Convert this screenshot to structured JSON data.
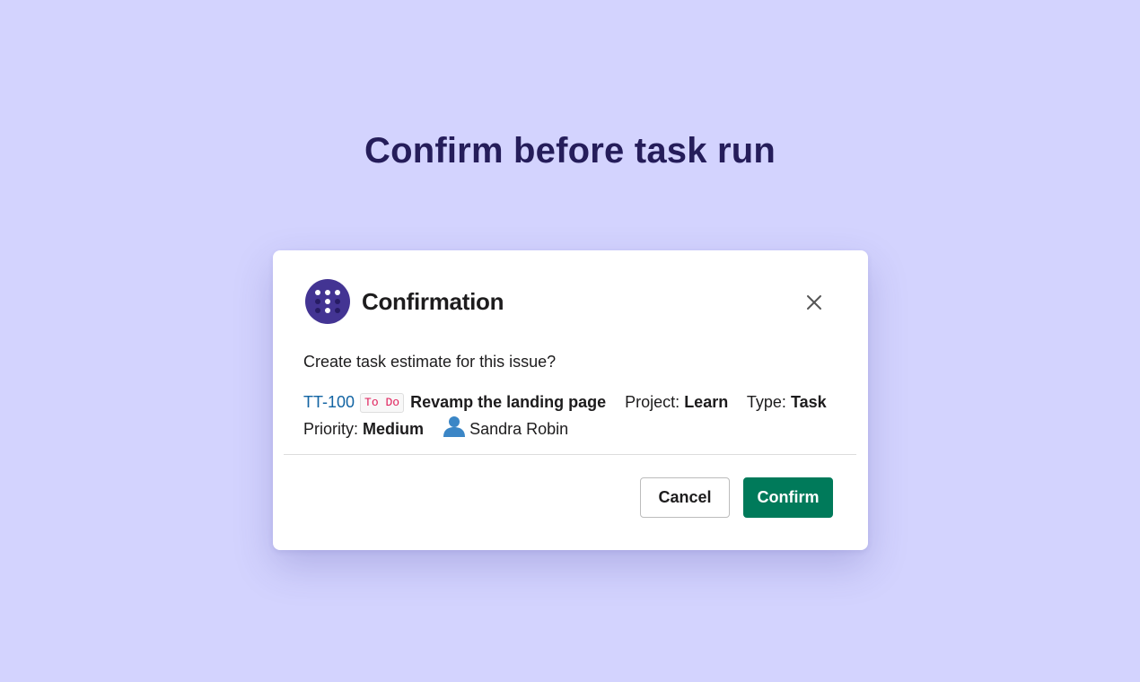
{
  "page": {
    "heading": "Confirm before task run",
    "background_color": "#d3d3fe"
  },
  "dialog": {
    "title": "Confirmation",
    "logo_icon": "dots-logo-icon",
    "close_icon": "close-icon",
    "question": "Create task estimate for this issue?",
    "issue": {
      "key": "TT-100",
      "status": "To Do",
      "summary": "Revamp the landing page",
      "project_label": "Project:",
      "project": "Learn",
      "type_label": "Type:",
      "type": "Task",
      "priority_label": "Priority:",
      "priority": "Medium",
      "assignee_icon": "user-icon",
      "assignee": "Sandra Robin"
    },
    "buttons": {
      "cancel": "Cancel",
      "confirm": "Confirm"
    }
  },
  "colors": {
    "accent": "#433493",
    "confirm": "#007a5a",
    "link": "#1264a3",
    "status_tag_text": "#e01e5a"
  }
}
